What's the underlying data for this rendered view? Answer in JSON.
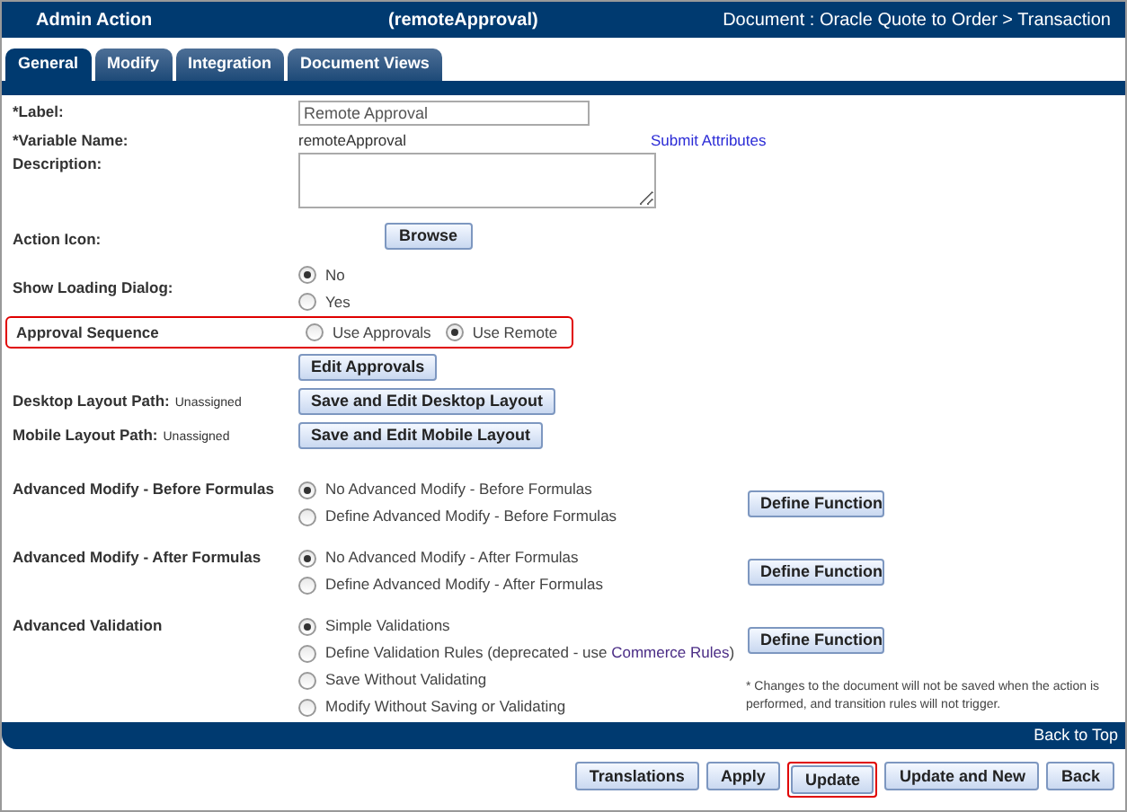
{
  "header": {
    "title": "Admin Action",
    "variable": "(remoteApproval)",
    "breadcrumb": "Document : Oracle Quote to Order > Transaction"
  },
  "tabs": [
    {
      "label": "General",
      "selected": true
    },
    {
      "label": "Modify",
      "selected": false
    },
    {
      "label": "Integration",
      "selected": false
    },
    {
      "label": "Document Views",
      "selected": false
    }
  ],
  "label_field": {
    "label": "*Label:",
    "value": "Remote Approval"
  },
  "variable_name": {
    "label": "*Variable Name:",
    "value": "remoteApproval",
    "link": "Submit Attributes"
  },
  "description": {
    "label": "Description:"
  },
  "action_icon": {
    "label": "Action Icon:",
    "button": "Browse"
  },
  "show_loading_dialog": {
    "label": "Show Loading Dialog:",
    "options": [
      {
        "label": "No",
        "selected": true
      },
      {
        "label": "Yes",
        "selected": false
      }
    ]
  },
  "approval_sequence": {
    "label": "Approval Sequence",
    "highlighted": true,
    "options": [
      {
        "label": "Use Approvals",
        "selected": false
      },
      {
        "label": "Use Remote",
        "selected": true
      }
    ],
    "button": "Edit Approvals"
  },
  "desktop_layout": {
    "label": "Desktop Layout Path:",
    "value": "Unassigned",
    "button": "Save and Edit Desktop Layout"
  },
  "mobile_layout": {
    "label": "Mobile Layout Path:",
    "value": "Unassigned",
    "button": "Save and Edit Mobile Layout"
  },
  "advanced_modify_before": {
    "label": "Advanced Modify - Before Formulas",
    "options": [
      {
        "label": "No Advanced Modify - Before Formulas",
        "selected": true
      },
      {
        "label": "Define Advanced Modify - Before Formulas",
        "selected": false
      }
    ],
    "button": "Define Function"
  },
  "advanced_modify_after": {
    "label": "Advanced Modify - After Formulas",
    "options": [
      {
        "label": "No Advanced Modify - After Formulas",
        "selected": true
      },
      {
        "label": "Define Advanced Modify - After Formulas",
        "selected": false
      }
    ],
    "button": "Define Function"
  },
  "advanced_validation": {
    "label": "Advanced Validation",
    "options": [
      {
        "label": "Simple Validations",
        "selected": true
      },
      {
        "label": "Define Validation Rules (deprecated - use ",
        "link": "Commerce Rules",
        "label_end": ")",
        "selected": false
      },
      {
        "label": "Save Without Validating",
        "selected": false
      },
      {
        "label": "Modify Without Saving or Validating",
        "selected": false
      }
    ],
    "button": "Define Function",
    "note": "* Changes to the document will not be saved when the action is performed, and transition rules will not trigger."
  },
  "footer_bar": {
    "link": "Back to Top"
  },
  "buttons": [
    {
      "label": "Translations",
      "highlighted": false
    },
    {
      "label": "Apply",
      "highlighted": false
    },
    {
      "label": "Update",
      "highlighted": true
    },
    {
      "label": "Update and New",
      "highlighted": false
    },
    {
      "label": "Back",
      "highlighted": false
    }
  ]
}
